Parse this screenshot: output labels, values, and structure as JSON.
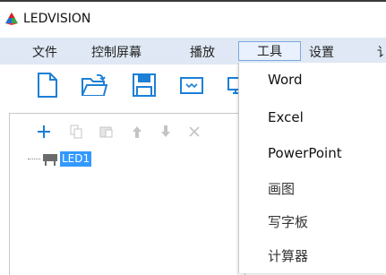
{
  "app": {
    "title": "LEDVISION",
    "logo_icon": "ledvision-logo"
  },
  "menubar": {
    "items": [
      {
        "label": "文件"
      },
      {
        "label": "控制屏幕"
      },
      {
        "label": "播放"
      },
      {
        "label": "工具",
        "active": true
      },
      {
        "label": "设置"
      },
      {
        "label": "讠"
      }
    ]
  },
  "toolbar": {
    "buttons": [
      {
        "icon": "new-file-icon"
      },
      {
        "icon": "open-folder-icon"
      },
      {
        "icon": "save-icon"
      },
      {
        "icon": "screen-icon"
      },
      {
        "icon": "computer-icon"
      }
    ]
  },
  "panel": {
    "toolbar_icons": [
      "add-icon",
      "copy-icon",
      "paste-icon",
      "move-up-icon",
      "move-down-icon",
      "close-icon"
    ],
    "tree": [
      {
        "label": "LED1",
        "icon": "led-screen-icon",
        "selected": true
      }
    ]
  },
  "dropdown": {
    "items": [
      {
        "label": "Word"
      },
      {
        "label": "Excel"
      },
      {
        "label": "PowerPoint"
      },
      {
        "label": "画图"
      },
      {
        "label": "写字板"
      },
      {
        "label": "计算器"
      }
    ]
  },
  "colors": {
    "menubar_bg": "#dfe8f4",
    "accent": "#1d7fd6",
    "selection": "#3399ff"
  }
}
